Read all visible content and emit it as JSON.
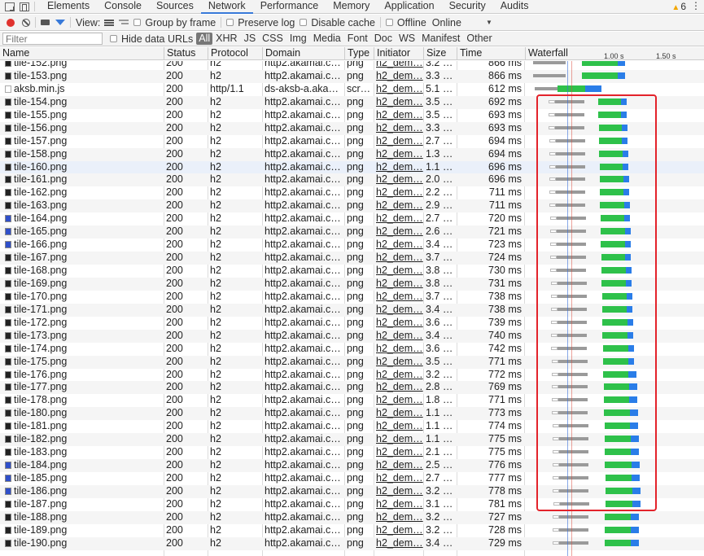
{
  "tabs": [
    "Elements",
    "Console",
    "Sources",
    "Network",
    "Performance",
    "Memory",
    "Application",
    "Security",
    "Audits"
  ],
  "active_tab": "Network",
  "warnings_count": "6",
  "toolbar": {
    "view_label": "View:",
    "group_by_frame": "Group by frame",
    "preserve_log": "Preserve log",
    "disable_cache": "Disable cache",
    "offline": "Offline",
    "throttle_value": "Online"
  },
  "filterbar": {
    "filter_placeholder": "Filter",
    "hide_data_urls": "Hide data URLs",
    "types": [
      "All",
      "XHR",
      "JS",
      "CSS",
      "Img",
      "Media",
      "Font",
      "Doc",
      "WS",
      "Manifest",
      "Other"
    ]
  },
  "columns": [
    "Name",
    "Status",
    "Protocol",
    "Domain",
    "Type",
    "Initiator",
    "Size",
    "Time",
    "Waterfall"
  ],
  "waterfall_ticks": [
    "1.00 s",
    "1.50 s"
  ],
  "colors": {
    "green": "#2ec14a",
    "blue": "#2a7de8",
    "highlight": "#e3232b"
  },
  "rows": [
    {
      "name": "tile-152.png",
      "status": "200",
      "protocol": "h2",
      "domain": "http2.akamai.c…",
      "type": "png",
      "initiator": "h2_dem…",
      "size": "3.2 …",
      "time": "866 ms",
      "icon": "dark"
    },
    {
      "name": "tile-153.png",
      "status": "200",
      "protocol": "h2",
      "domain": "http2.akamai.c…",
      "type": "png",
      "initiator": "h2_dem…",
      "size": "3.3 …",
      "time": "866 ms",
      "icon": "dark"
    },
    {
      "name": "aksb.min.js",
      "status": "200",
      "protocol": "http/1.1",
      "domain": "ds-aksb-a.aka…",
      "type": "scr…",
      "initiator": "h2_dem…",
      "size": "5.1 …",
      "time": "612 ms",
      "icon": "js"
    },
    {
      "name": "tile-154.png",
      "status": "200",
      "protocol": "h2",
      "domain": "http2.akamai.c…",
      "type": "png",
      "initiator": "h2_dem…",
      "size": "3.5 …",
      "time": "692 ms",
      "icon": "dark"
    },
    {
      "name": "tile-155.png",
      "status": "200",
      "protocol": "h2",
      "domain": "http2.akamai.c…",
      "type": "png",
      "initiator": "h2_dem…",
      "size": "3.5 …",
      "time": "693 ms",
      "icon": "dark"
    },
    {
      "name": "tile-156.png",
      "status": "200",
      "protocol": "h2",
      "domain": "http2.akamai.c…",
      "type": "png",
      "initiator": "h2_dem…",
      "size": "3.3 …",
      "time": "693 ms",
      "icon": "dark"
    },
    {
      "name": "tile-157.png",
      "status": "200",
      "protocol": "h2",
      "domain": "http2.akamai.c…",
      "type": "png",
      "initiator": "h2_dem…",
      "size": "2.7 …",
      "time": "694 ms",
      "icon": "dark"
    },
    {
      "name": "tile-158.png",
      "status": "200",
      "protocol": "h2",
      "domain": "http2.akamai.c…",
      "type": "png",
      "initiator": "h2_dem…",
      "size": "1.3 …",
      "time": "694 ms",
      "icon": "dark"
    },
    {
      "name": "tile-160.png",
      "status": "200",
      "protocol": "h2",
      "domain": "http2.akamai.c…",
      "type": "png",
      "initiator": "h2_dem…",
      "size": "1.1 …",
      "time": "696 ms",
      "icon": "dark"
    },
    {
      "name": "tile-161.png",
      "status": "200",
      "protocol": "h2",
      "domain": "http2.akamai.c…",
      "type": "png",
      "initiator": "h2_dem…",
      "size": "2.0 …",
      "time": "696 ms",
      "icon": "dark"
    },
    {
      "name": "tile-162.png",
      "status": "200",
      "protocol": "h2",
      "domain": "http2.akamai.c…",
      "type": "png",
      "initiator": "h2_dem…",
      "size": "2.2 …",
      "time": "711 ms",
      "icon": "dark"
    },
    {
      "name": "tile-163.png",
      "status": "200",
      "protocol": "h2",
      "domain": "http2.akamai.c…",
      "type": "png",
      "initiator": "h2_dem…",
      "size": "2.9 …",
      "time": "711 ms",
      "icon": "dark"
    },
    {
      "name": "tile-164.png",
      "status": "200",
      "protocol": "h2",
      "domain": "http2.akamai.c…",
      "type": "png",
      "initiator": "h2_dem…",
      "size": "2.7 …",
      "time": "720 ms",
      "icon": "blue"
    },
    {
      "name": "tile-165.png",
      "status": "200",
      "protocol": "h2",
      "domain": "http2.akamai.c…",
      "type": "png",
      "initiator": "h2_dem…",
      "size": "2.6 …",
      "time": "721 ms",
      "icon": "blue"
    },
    {
      "name": "tile-166.png",
      "status": "200",
      "protocol": "h2",
      "domain": "http2.akamai.c…",
      "type": "png",
      "initiator": "h2_dem…",
      "size": "3.4 …",
      "time": "723 ms",
      "icon": "blue"
    },
    {
      "name": "tile-167.png",
      "status": "200",
      "protocol": "h2",
      "domain": "http2.akamai.c…",
      "type": "png",
      "initiator": "h2_dem…",
      "size": "3.7 …",
      "time": "724 ms",
      "icon": "dark"
    },
    {
      "name": "tile-168.png",
      "status": "200",
      "protocol": "h2",
      "domain": "http2.akamai.c…",
      "type": "png",
      "initiator": "h2_dem…",
      "size": "3.8 …",
      "time": "730 ms",
      "icon": "dark"
    },
    {
      "name": "tile-169.png",
      "status": "200",
      "protocol": "h2",
      "domain": "http2.akamai.c…",
      "type": "png",
      "initiator": "h2_dem…",
      "size": "3.8 …",
      "time": "731 ms",
      "icon": "dark"
    },
    {
      "name": "tile-170.png",
      "status": "200",
      "protocol": "h2",
      "domain": "http2.akamai.c…",
      "type": "png",
      "initiator": "h2_dem…",
      "size": "3.7 …",
      "time": "738 ms",
      "icon": "dark"
    },
    {
      "name": "tile-171.png",
      "status": "200",
      "protocol": "h2",
      "domain": "http2.akamai.c…",
      "type": "png",
      "initiator": "h2_dem…",
      "size": "3.4 …",
      "time": "738 ms",
      "icon": "dark"
    },
    {
      "name": "tile-172.png",
      "status": "200",
      "protocol": "h2",
      "domain": "http2.akamai.c…",
      "type": "png",
      "initiator": "h2_dem…",
      "size": "3.6 …",
      "time": "739 ms",
      "icon": "dark"
    },
    {
      "name": "tile-173.png",
      "status": "200",
      "protocol": "h2",
      "domain": "http2.akamai.c…",
      "type": "png",
      "initiator": "h2_dem…",
      "size": "3.4 …",
      "time": "740 ms",
      "icon": "dark"
    },
    {
      "name": "tile-174.png",
      "status": "200",
      "protocol": "h2",
      "domain": "http2.akamai.c…",
      "type": "png",
      "initiator": "h2_dem…",
      "size": "3.6 …",
      "time": "742 ms",
      "icon": "dark"
    },
    {
      "name": "tile-175.png",
      "status": "200",
      "protocol": "h2",
      "domain": "http2.akamai.c…",
      "type": "png",
      "initiator": "h2_dem…",
      "size": "3.5 …",
      "time": "771 ms",
      "icon": "dark"
    },
    {
      "name": "tile-176.png",
      "status": "200",
      "protocol": "h2",
      "domain": "http2.akamai.c…",
      "type": "png",
      "initiator": "h2_dem…",
      "size": "3.2 …",
      "time": "772 ms",
      "icon": "dark"
    },
    {
      "name": "tile-177.png",
      "status": "200",
      "protocol": "h2",
      "domain": "http2.akamai.c…",
      "type": "png",
      "initiator": "h2_dem…",
      "size": "2.8 …",
      "time": "769 ms",
      "icon": "dark"
    },
    {
      "name": "tile-178.png",
      "status": "200",
      "protocol": "h2",
      "domain": "http2.akamai.c…",
      "type": "png",
      "initiator": "h2_dem…",
      "size": "1.8 …",
      "time": "771 ms",
      "icon": "dark"
    },
    {
      "name": "tile-180.png",
      "status": "200",
      "protocol": "h2",
      "domain": "http2.akamai.c…",
      "type": "png",
      "initiator": "h2_dem…",
      "size": "1.1 …",
      "time": "773 ms",
      "icon": "dark"
    },
    {
      "name": "tile-181.png",
      "status": "200",
      "protocol": "h2",
      "domain": "http2.akamai.c…",
      "type": "png",
      "initiator": "h2_dem…",
      "size": "1.1 …",
      "time": "774 ms",
      "icon": "dark"
    },
    {
      "name": "tile-182.png",
      "status": "200",
      "protocol": "h2",
      "domain": "http2.akamai.c…",
      "type": "png",
      "initiator": "h2_dem…",
      "size": "1.1 …",
      "time": "775 ms",
      "icon": "dark"
    },
    {
      "name": "tile-183.png",
      "status": "200",
      "protocol": "h2",
      "domain": "http2.akamai.c…",
      "type": "png",
      "initiator": "h2_dem…",
      "size": "2.1 …",
      "time": "775 ms",
      "icon": "dark"
    },
    {
      "name": "tile-184.png",
      "status": "200",
      "protocol": "h2",
      "domain": "http2.akamai.c…",
      "type": "png",
      "initiator": "h2_dem…",
      "size": "2.5 …",
      "time": "776 ms",
      "icon": "blue"
    },
    {
      "name": "tile-185.png",
      "status": "200",
      "protocol": "h2",
      "domain": "http2.akamai.c…",
      "type": "png",
      "initiator": "h2_dem…",
      "size": "2.7 …",
      "time": "777 ms",
      "icon": "blue"
    },
    {
      "name": "tile-186.png",
      "status": "200",
      "protocol": "h2",
      "domain": "http2.akamai.c…",
      "type": "png",
      "initiator": "h2_dem…",
      "size": "3.2 …",
      "time": "778 ms",
      "icon": "blue"
    },
    {
      "name": "tile-187.png",
      "status": "200",
      "protocol": "h2",
      "domain": "http2.akamai.c…",
      "type": "png",
      "initiator": "h2_dem…",
      "size": "3.1 …",
      "time": "781 ms",
      "icon": "dark"
    },
    {
      "name": "tile-188.png",
      "status": "200",
      "protocol": "h2",
      "domain": "http2.akamai.c…",
      "type": "png",
      "initiator": "h2_dem…",
      "size": "3.2 …",
      "time": "727 ms",
      "icon": "dark"
    },
    {
      "name": "tile-189.png",
      "status": "200",
      "protocol": "h2",
      "domain": "http2.akamai.c…",
      "type": "png",
      "initiator": "h2_dem…",
      "size": "3.2 …",
      "time": "728 ms",
      "icon": "dark"
    },
    {
      "name": "tile-190.png",
      "status": "200",
      "protocol": "h2",
      "domain": "http2.akamai.c…",
      "type": "png",
      "initiator": "h2_dem…",
      "size": "3.4 …",
      "time": "729 ms",
      "icon": "dark"
    }
  ]
}
